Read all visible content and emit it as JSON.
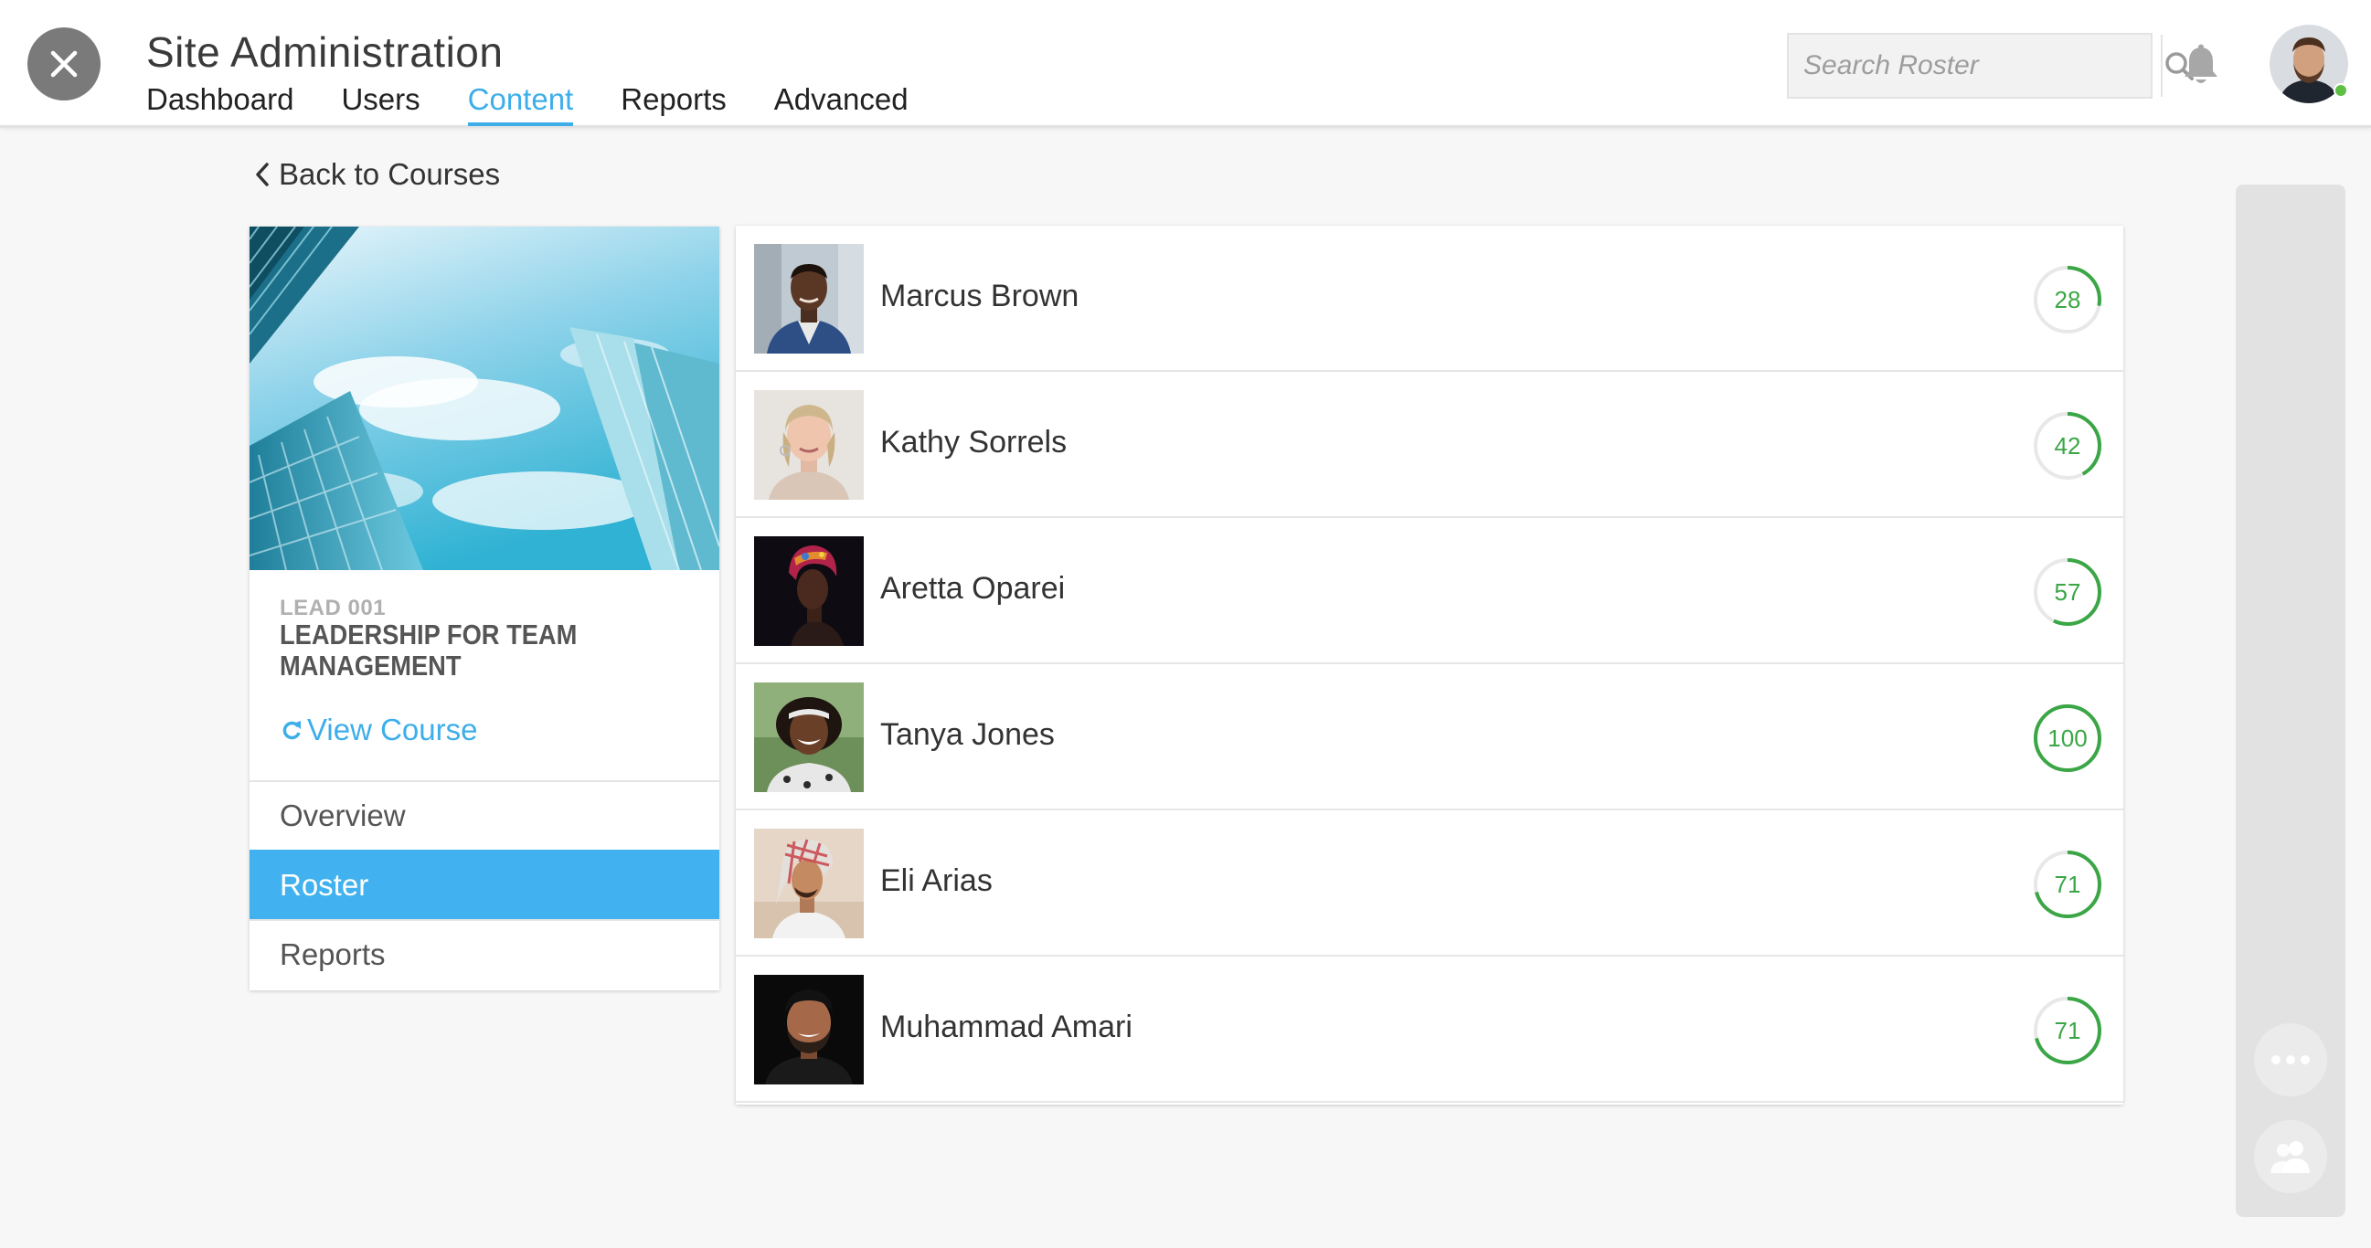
{
  "header": {
    "title": "Site Administration",
    "tabs": [
      {
        "label": "Dashboard"
      },
      {
        "label": "Users"
      },
      {
        "label": "Content"
      },
      {
        "label": "Reports"
      },
      {
        "label": "Advanced"
      }
    ],
    "active_tab": "Content",
    "search_placeholder": "Search Roster",
    "online_status_color": "#5fbf44"
  },
  "back_link": {
    "label": "Back to Courses"
  },
  "course": {
    "code": "LEAD 001",
    "name": "LEADERSHIP FOR TEAM MANAGEMENT",
    "view_label": "View Course",
    "nav": [
      {
        "label": "Overview"
      },
      {
        "label": "Roster"
      },
      {
        "label": "Reports"
      }
    ],
    "active_nav": "Roster"
  },
  "roster": [
    {
      "name": "Marcus Brown",
      "score": "28",
      "progress": 0.28
    },
    {
      "name": "Kathy Sorrels",
      "score": "42",
      "progress": 0.42
    },
    {
      "name": "Aretta Oparei",
      "score": "57",
      "progress": 0.57
    },
    {
      "name": "Tanya Jones",
      "score": "100",
      "progress": 1.0
    },
    {
      "name": "Eli Arias",
      "score": "71",
      "progress": 0.71
    },
    {
      "name": "Muhammad Amari",
      "score": "71",
      "progress": 0.71
    }
  ],
  "colors": {
    "accent": "#3daee9",
    "progress": "#3aa645",
    "nav_active": "#41b2ef"
  },
  "icons": {
    "close": "close-icon",
    "search": "search-icon",
    "bell": "bell-icon",
    "back": "chevron-left-icon",
    "view_course": "refresh-icon",
    "more": "more-icon",
    "group": "group-icon"
  }
}
